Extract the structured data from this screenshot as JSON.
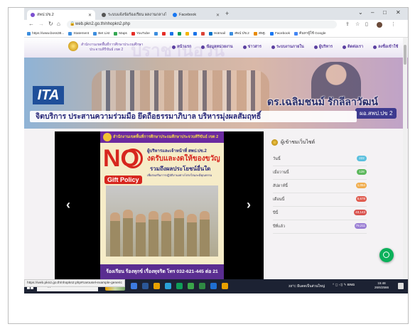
{
  "browser": {
    "tabs": [
      {
        "title": "สพป.ปข.2",
        "active": true,
        "fav_color": "#7b4fd0"
      },
      {
        "title": "ระบบแจ้งข้อร้องเรียน ผลงานกลางในระบบ สพป.",
        "active": false,
        "fav_color": "#555555"
      },
      {
        "title": "Facebook",
        "active": false,
        "fav_color": "#1877f2"
      }
    ],
    "new_tab": "+",
    "window_controls": [
      "⌄",
      "–",
      "□",
      "✕"
    ],
    "url": "web.pkn2.go.th/nhopkn2.php",
    "bookmarks": [
      {
        "label": "https://www.boss38...",
        "color": "#3c8dde"
      },
      {
        "label": "Statement",
        "color": "#3c8dde"
      },
      {
        "label": "Bet List",
        "color": "#3c8dde"
      },
      {
        "label": "Maps",
        "color": "#34a853"
      },
      {
        "label": "YouTube",
        "color": "#e52d27"
      },
      {
        "label": "",
        "color": "#3c8dde"
      },
      {
        "label": "",
        "color": "#e52d27"
      },
      {
        "label": "",
        "color": "#1a73e8"
      },
      {
        "label": "",
        "color": "#0f9d58"
      },
      {
        "label": "",
        "color": "#f4b400"
      },
      {
        "label": "",
        "color": "#1a73e8"
      },
      {
        "label": "",
        "color": "#db4437"
      },
      {
        "label": "Hotmail",
        "color": "#0072c6"
      },
      {
        "label": "สพป.ปข.2",
        "color": "#3c8dde"
      },
      {
        "label": "สพฐ.",
        "color": "#e88a00"
      },
      {
        "label": "Facebook",
        "color": "#1877f2"
      },
      {
        "label": "ค้นหาผู้ใช้ Google",
        "color": "#4285f4"
      }
    ]
  },
  "site": {
    "name_line1": "สำนักงานเขตพื้นที่การศึกษาประถมศึกษา",
    "name_line2": "ประจวบคีรีขันธ์ เขต 2",
    "watermark": "ปราชานอวน",
    "menu": [
      "หน้าแรก",
      "ข้อมูลหน่วยงาน",
      "ข่าวสาร",
      "ระบบงานภายใน",
      "ผู้บริหาร",
      "ติดต่อเรา",
      "ลงชื่อเข้าใช้"
    ]
  },
  "banner": {
    "ita": "ITA",
    "director": "ดร.เฉลิมชนม์ รักลีลาวัฒน์",
    "area": "ผอ.สพป.ปข 2",
    "slogan": "จิตบริการ ประสานความร่วมมือ ยึดถือธรรมาภิบาล บริหารมุ่งผลสัมฤทธิ์"
  },
  "slide": {
    "header": "สำนักงานเขตพื้นที่การศึกษาประถมศึกษาประจวบคีรีขันธ์ เขต 2",
    "no": "NO",
    "gift_policy": "Gift Policy",
    "line1": "ผู้บริหารและเจ้าหน้าที่ สพป.ปข.2",
    "line2": "งดรับและงดให้ของขวัญ",
    "line3": "รวมถึงผลประโยชน์อื่นใด",
    "line4": "เพื่อส่งเสริมการปฏิบัติงานอย่างโปร่งใสและมีคุณธรรม",
    "footer": "ร้องเรียน ร้องทุกข์ เรื่องทุจริต โทร 032-621-445 ต่อ 21",
    "prev": "‹",
    "next": "›"
  },
  "stats": {
    "title": "ผู้เข้าชมเว็บไซต์",
    "rows": [
      {
        "label": "วันนี้",
        "value": "222",
        "color": "#5bc0de"
      },
      {
        "label": "เมื่อวานนี้",
        "value": "128",
        "color": "#5cb85c"
      },
      {
        "label": "สัปดาห์นี้",
        "value": "1,054",
        "color": "#f0ad4e"
      },
      {
        "label": "เดือนนี้",
        "value": "5,678",
        "color": "#e05c4f"
      },
      {
        "label": "ปีนี้",
        "value": "43,143",
        "color": "#d9534f"
      },
      {
        "label": "ปีที่แล้ว",
        "value": "79,211",
        "color": "#9b7fd4"
      }
    ]
  },
  "status_url": "https://web.pkn2.go.th/nhopkn2.php#carousel-example-generic",
  "taskbar": {
    "search_placeholder": "Type here to search",
    "weather": "33°C มีแดดเป็นส่วนใหญ่",
    "lang": "ENG",
    "time": "15:48",
    "date": "26/6/2566",
    "icon_colors": [
      "#e8a100",
      "#3d7be0",
      "#2b5797",
      "#3d7be0",
      "#2aa1d8",
      "#0f9d58",
      "#3aa64a",
      "#2f8a43",
      "#1f6fd1",
      "#e8a100"
    ]
  }
}
